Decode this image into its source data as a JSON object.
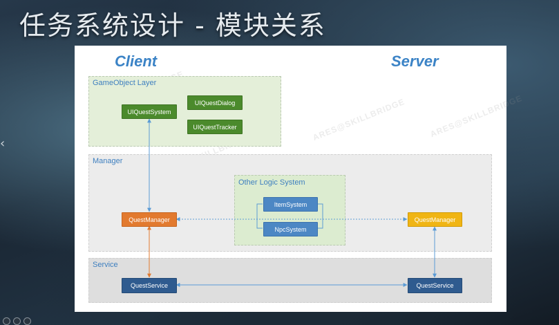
{
  "slide_title": "任务系统设计 - 模块关系",
  "client_heading": "Client",
  "server_heading": "Server",
  "layers": {
    "gameobject": "GameObject Layer",
    "manager": "Manager",
    "other_logic": "Other Logic System",
    "service": "Service"
  },
  "modules": {
    "ui_quest_system": "UIQuestSystem",
    "ui_quest_dialog": "UIQuestDialog",
    "ui_quest_tracker": "UIQuestTracker",
    "quest_manager_client": "QuestManager",
    "item_system": "ItemSystem",
    "npc_system": "NpcSystem",
    "quest_manager_server": "QuestManager",
    "quest_service_client": "QuestService",
    "quest_service_server": "QuestService"
  },
  "watermark": "ARES@SKILLBRIDGE",
  "colors": {
    "heading": "#3b83c6",
    "ui_module": "#4b8a2c",
    "client_manager": "#e27a2f",
    "server_manager": "#f0b514",
    "service": "#2f5b8f",
    "logic_system": "#4c87c4",
    "link": "#5b9bd5",
    "service_link": "#e27a2f"
  },
  "icons": {
    "prev": "chevron-left-icon"
  }
}
